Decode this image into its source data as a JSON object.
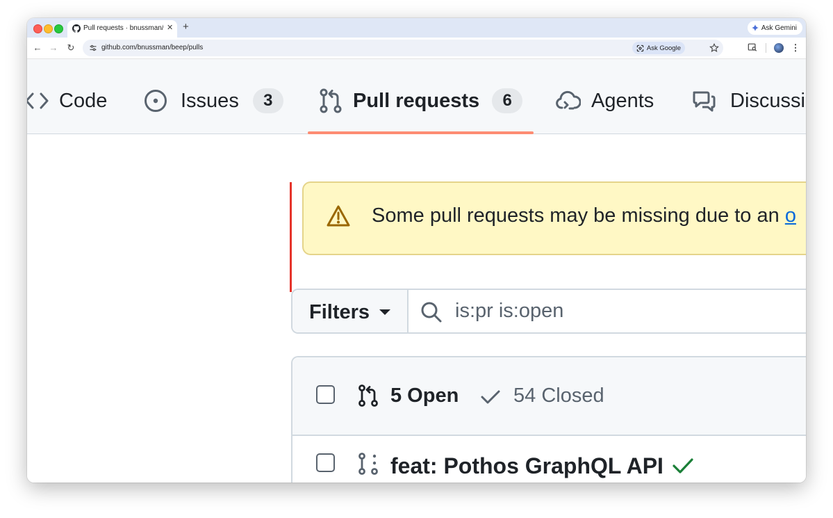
{
  "browser": {
    "tab_title": "Pull requests · bnussman/beep",
    "tab_close": "✕",
    "new_tab": "+",
    "gemini_label": "Ask Gemini",
    "url": "github.com/bnussman/beep/pulls",
    "ask_google_label": "Ask Google"
  },
  "repo_nav": {
    "items": [
      {
        "label": "Code",
        "icon": "code-icon"
      },
      {
        "label": "Issues",
        "icon": "issue-opened-icon",
        "count": "3"
      },
      {
        "label": "Pull requests",
        "icon": "git-pull-request-icon",
        "count": "6",
        "selected": true
      },
      {
        "label": "Agents",
        "icon": "agent-cloud-icon"
      },
      {
        "label": "Discussi",
        "icon": "comment-discussion-icon"
      }
    ]
  },
  "flash": {
    "text": "Some pull requests may be missing due to an ",
    "link_text": "o"
  },
  "filters": {
    "label": "Filters",
    "query": "is:pr is:open"
  },
  "list": {
    "open_label": "5 Open",
    "closed_label": "54 Closed",
    "rows": [
      {
        "title": "feat: Pothos GraphQL API",
        "status": "success"
      }
    ]
  },
  "colors": {
    "selected_underline": "#fd8c73",
    "flash_bg": "#fff8c5",
    "link": "#0969da",
    "success": "#1a7f37"
  }
}
